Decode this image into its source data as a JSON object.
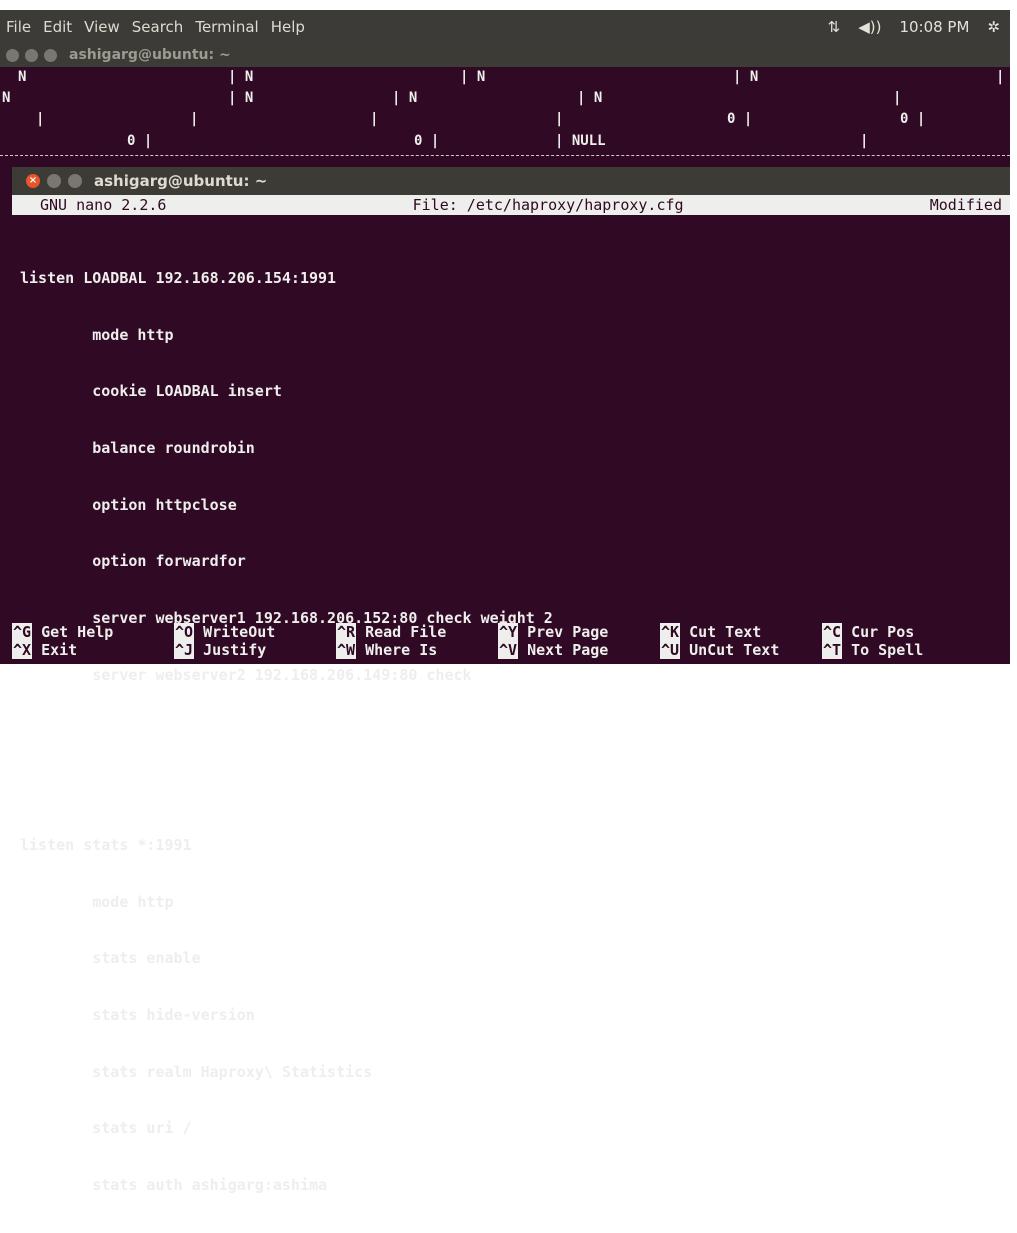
{
  "menubar": {
    "menus": [
      "File",
      "Edit",
      "View",
      "Search",
      "Terminal",
      "Help"
    ],
    "network_icon": "network-updown-icon",
    "volume_icon": "volume-icon",
    "clock": "10:08 PM",
    "settings_icon": "gear-icon"
  },
  "background_terminal": {
    "title": "ashigarg@ubuntu: ~",
    "rows": [
      [
        "N",
        "| N",
        "| N",
        "| N",
        "|"
      ],
      [
        "N",
        "| N",
        "| N",
        "| N",
        "|"
      ],
      [
        "|",
        "|",
        "|",
        "|",
        "0 |",
        "0 |"
      ],
      [
        "0 |",
        "0 |",
        "| NULL",
        "|"
      ]
    ]
  },
  "foreground_terminal": {
    "title": "ashigarg@ubuntu: ~",
    "nano": {
      "version": "GNU nano 2.2.6",
      "file": "File: /etc/haproxy/haproxy.cfg",
      "status": "Modified"
    },
    "lines": [
      "listen LOADBAL 192.168.206.154:1991",
      "        mode http",
      "        cookie LOADBAL insert",
      "        balance roundrobin",
      "        option httpclose",
      "        option forwardfor",
      "        server webserver1 192.168.206.152:80 check weight 2",
      "        server webserver2 192.168.206.149:80 check",
      "",
      "",
      "listen stats *:1991",
      "        mode http",
      "        stats enable",
      "        stats hide-version",
      "        stats realm Haproxy\\ Statistics",
      "        stats uri /",
      "        stats auth ashigarg:ashima"
    ],
    "shortcuts_row1": [
      {
        "key": "^G",
        "label": "Get Help"
      },
      {
        "key": "^O",
        "label": "WriteOut"
      },
      {
        "key": "^R",
        "label": "Read File"
      },
      {
        "key": "^Y",
        "label": "Prev Page"
      },
      {
        "key": "^K",
        "label": "Cut Text"
      },
      {
        "key": "^C",
        "label": "Cur Pos"
      }
    ],
    "shortcuts_row2": [
      {
        "key": "^X",
        "label": "Exit"
      },
      {
        "key": "^J",
        "label": "Justify"
      },
      {
        "key": "^W",
        "label": "Where Is"
      },
      {
        "key": "^V",
        "label": "Next Page"
      },
      {
        "key": "^U",
        "label": "UnCut Text"
      },
      {
        "key": "^T",
        "label": "To Spell"
      }
    ]
  }
}
